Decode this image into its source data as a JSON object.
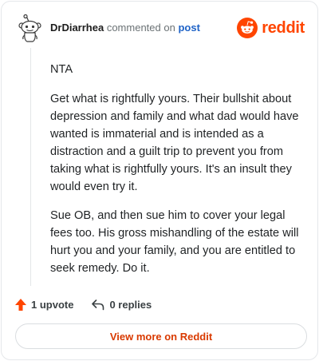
{
  "comment": {
    "username": "DrDiarrhea",
    "action_text": "commented on",
    "post_link_text": "post",
    "paragraphs": [
      "NTA",
      "Get what is rightfully yours. Their bullshit about depression and family and what dad would have wanted is immaterial and is intended as a distraction and a guilt trip to prevent you from taking what is rightfully yours. It's an insult they would even try it.",
      "Sue OB, and then sue him to cover your legal fees too. His gross mishandling of the estate will hurt you and your family, and you are entitled to seek remedy. Do it."
    ]
  },
  "brand": {
    "wordmark": "reddit",
    "icon": "reddit-snoo-icon",
    "color": "#ff4500"
  },
  "avatar": {
    "icon": "snoo-avatar-icon"
  },
  "actions": {
    "upvote_label": "1 upvote",
    "replies_label": "0 replies",
    "upvote_icon": "upvote-arrow-icon",
    "reply_icon": "reply-arrow-icon",
    "upvote_color": "#ff4500"
  },
  "footer": {
    "view_more_label": "View more on Reddit"
  }
}
